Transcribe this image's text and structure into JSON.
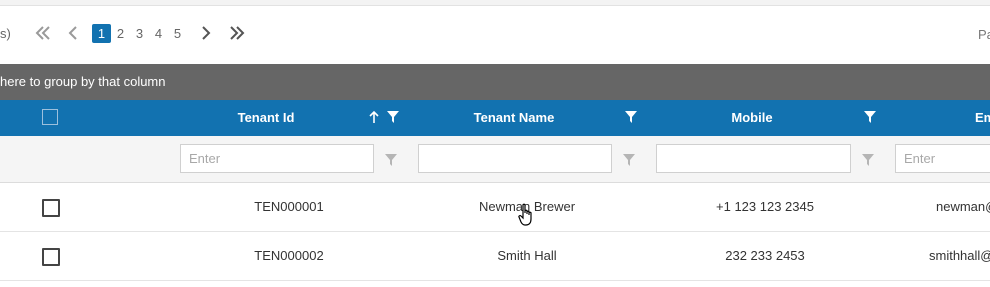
{
  "pager": {
    "count_suffix": "s)",
    "pages": [
      "1",
      "2",
      "3",
      "4",
      "5"
    ],
    "active_page": "1",
    "page_info": "Pa"
  },
  "group_panel": {
    "text": "here to group by that column"
  },
  "columns": {
    "tenant_id": "Tenant Id",
    "tenant_name": "Tenant Name",
    "mobile": "Mobile",
    "email": "Em"
  },
  "filters": {
    "tenant_id": {
      "placeholder": "Enter",
      "value": ""
    },
    "tenant_name": {
      "placeholder": "",
      "value": ""
    },
    "mobile": {
      "placeholder": "",
      "value": ""
    },
    "email": {
      "placeholder": "Enter",
      "value": ""
    }
  },
  "rows": [
    {
      "tenant_id": "TEN000001",
      "tenant_name": "Newman Brewer",
      "mobile": "+1 123 123 2345",
      "email": "newman@"
    },
    {
      "tenant_id": "TEN000002",
      "tenant_name": "Smith Hall",
      "mobile": "232 233 2453",
      "email": "smithhall@"
    }
  ],
  "colors": {
    "header_bg": "#1272b0",
    "group_panel_bg": "#666666",
    "active_page_bg": "#1272b0"
  },
  "icons": [
    "first-page-icon",
    "prev-page-icon",
    "next-page-icon",
    "last-page-icon",
    "sort-asc-icon",
    "filter-icon",
    "hand-cursor-icon"
  ]
}
